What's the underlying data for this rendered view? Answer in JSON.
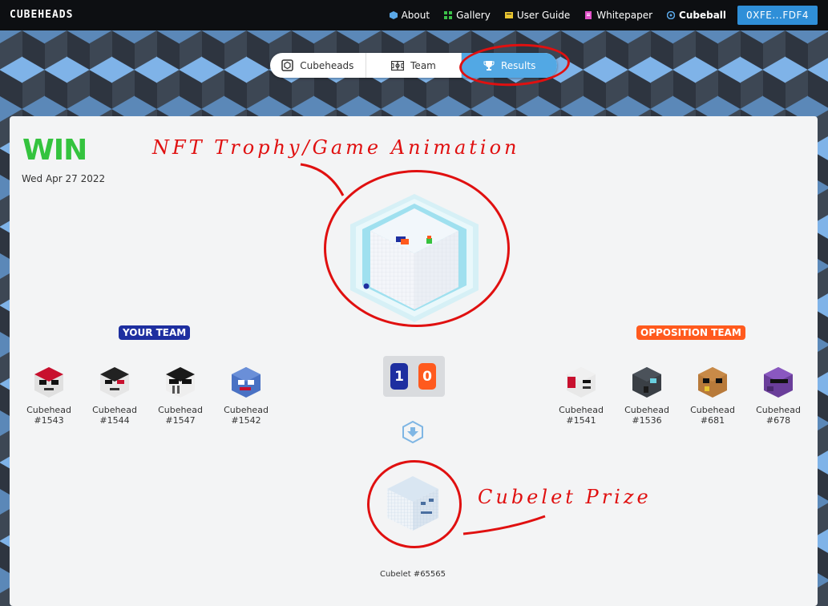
{
  "brand": {
    "logo": "CUBEHEADS"
  },
  "nav": {
    "items": [
      {
        "label": "About",
        "icon": "cube-icon",
        "color": "#5aa8e8"
      },
      {
        "label": "Gallery",
        "icon": "grid-icon",
        "color": "#3cc24a"
      },
      {
        "label": "User Guide",
        "icon": "book-icon",
        "color": "#e8c430"
      },
      {
        "label": "Whitepaper",
        "icon": "document-icon",
        "color": "#e050c8"
      },
      {
        "label": "Cubeball",
        "icon": "ball-icon",
        "color": "#5aa8e8"
      }
    ],
    "wallet": "0XFE...FDF4"
  },
  "tabs": [
    {
      "label": "Cubeheads",
      "icon": "cube-outline-icon"
    },
    {
      "label": "Team",
      "icon": "field-icon"
    },
    {
      "label": "Results",
      "icon": "trophy-icon",
      "active": true
    }
  ],
  "result": {
    "outcome": "WIN",
    "date": "Wed Apr 27 2022"
  },
  "annotations": {
    "trophy": "NFT Trophy/Game Animation",
    "prize": "Cubelet Prize"
  },
  "your_team": {
    "label": "YOUR TEAM",
    "color": "#1e2fa0",
    "players": [
      {
        "name": "Cubehead",
        "id": "#1543"
      },
      {
        "name": "Cubehead",
        "id": "#1544"
      },
      {
        "name": "Cubehead",
        "id": "#1547"
      },
      {
        "name": "Cubehead",
        "id": "#1542"
      }
    ]
  },
  "opposition_team": {
    "label": "OPPOSITION TEAM",
    "color": "#ff5a1e",
    "players": [
      {
        "name": "Cubehead",
        "id": "#1541"
      },
      {
        "name": "Cubehead",
        "id": "#1536"
      },
      {
        "name": "Cubehead",
        "id": "#681"
      },
      {
        "name": "Cubehead",
        "id": "#678"
      }
    ]
  },
  "score": {
    "home": "1",
    "away": "0",
    "home_color": "#1e2fa0",
    "away_color": "#ff5a1e"
  },
  "prize": {
    "label": "Cubelet #65565"
  }
}
